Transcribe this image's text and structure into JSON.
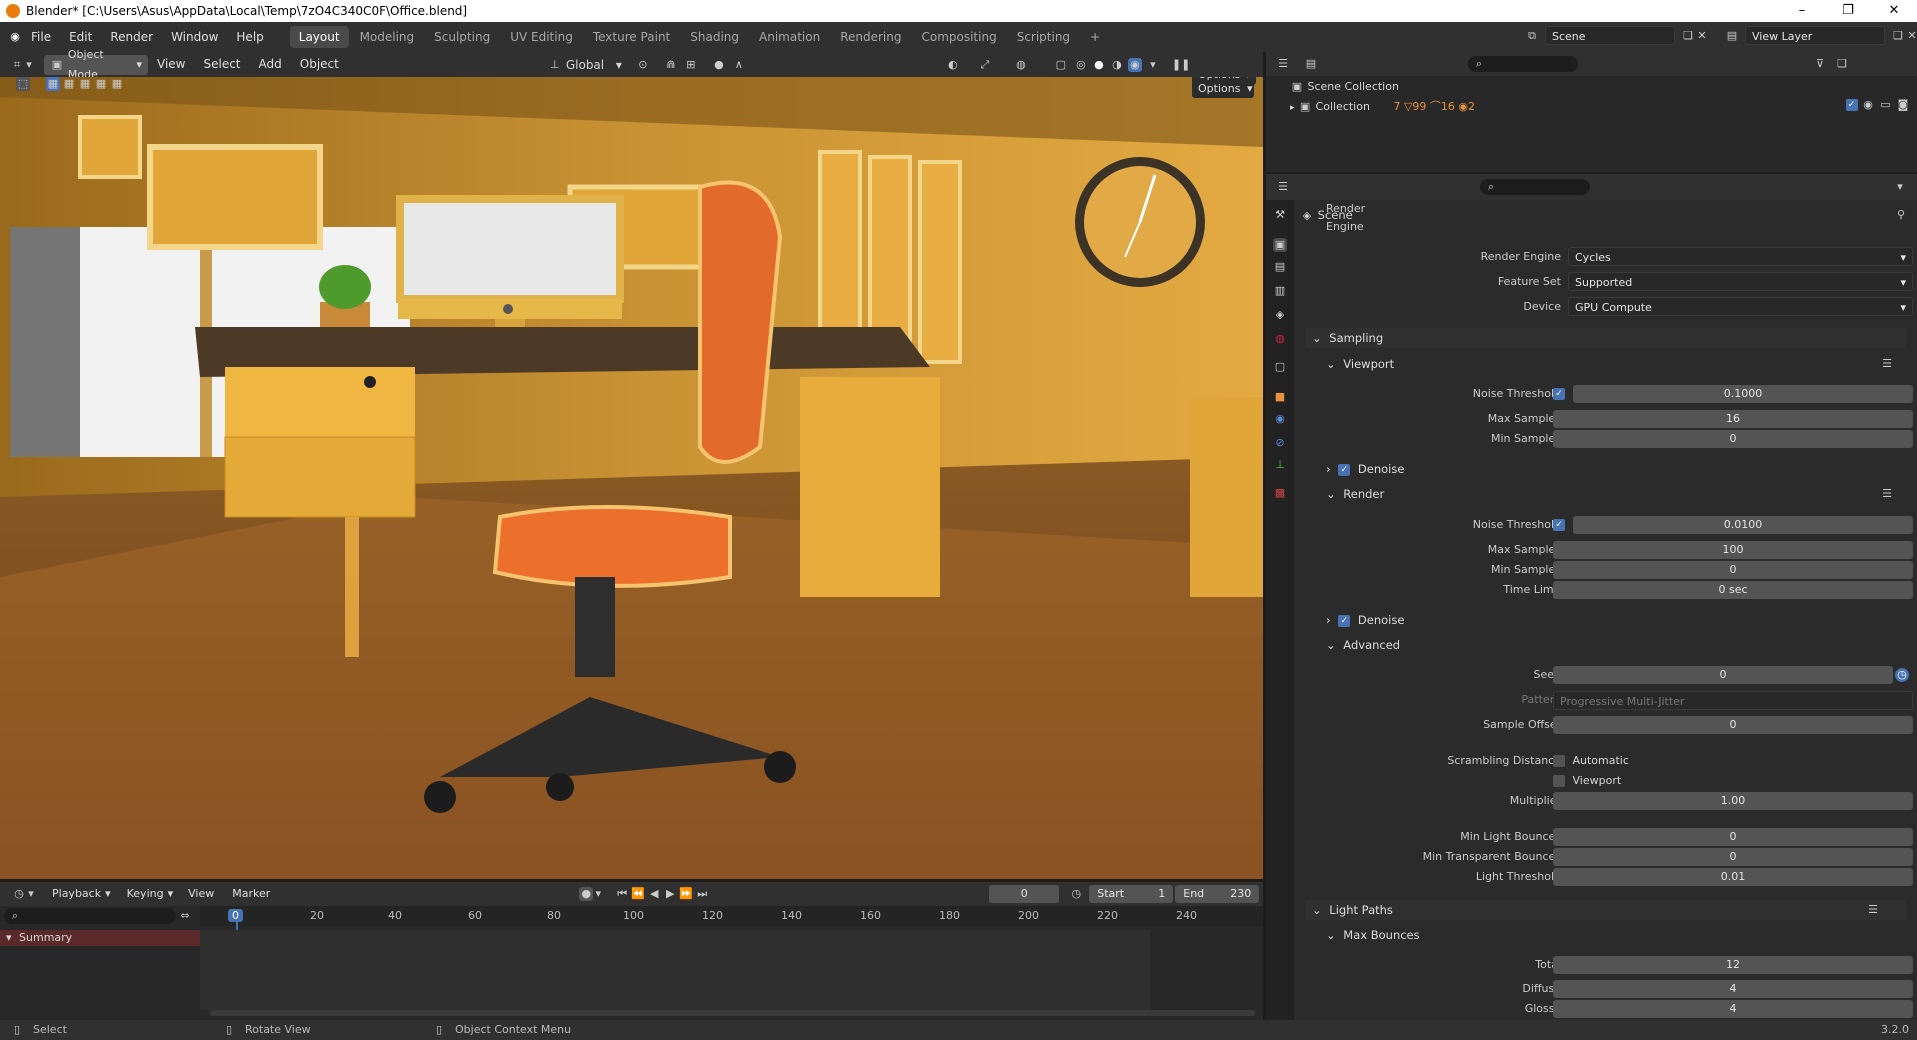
{
  "window": {
    "title": "Blender* [C:\\Users\\Asus\\AppData\\Local\\Temp\\7zO4C340C0F\\Office.blend]",
    "controls": [
      "–",
      "❐",
      "✕"
    ]
  },
  "topbar": {
    "menus": [
      "File",
      "Edit",
      "Render",
      "Window",
      "Help"
    ],
    "workspaces": [
      "Layout",
      "Modeling",
      "Sculpting",
      "UV Editing",
      "Texture Paint",
      "Shading",
      "Animation",
      "Rendering",
      "Compositing",
      "Scripting"
    ],
    "active_workspace": "Layout",
    "add_workspace": "+",
    "scene": "Scene",
    "view_layer": "View Layer"
  },
  "viewport_header": {
    "mode": "Object Mode",
    "menus": [
      "View",
      "Select",
      "Add",
      "Object"
    ],
    "orientation": "Global",
    "options": "Options"
  },
  "timeline": {
    "menus": [
      "Playback",
      "Keying",
      "View",
      "Marker"
    ],
    "current_frame": "0",
    "start_label": "Start",
    "start": "1",
    "end_label": "End",
    "end": "230",
    "ruler": [
      "0",
      "20",
      "40",
      "60",
      "80",
      "100",
      "120",
      "140",
      "160",
      "180",
      "200",
      "220",
      "240"
    ],
    "summary": "Summary"
  },
  "statusbar": {
    "select": "Select",
    "rotate": "Rotate View",
    "context": "Object Context Menu",
    "version": "3.2.0"
  },
  "outliner": {
    "scene_collection": "Scene Collection",
    "collection": "Collection",
    "counts": [
      "7",
      "99",
      "16",
      "2"
    ]
  },
  "properties": {
    "context": "Scene",
    "render_engine_label": "Render Engine",
    "render_engine": "Cycles",
    "feature_set_label": "Feature Set",
    "feature_set": "Supported",
    "device_label": "Device",
    "device": "GPU Compute",
    "sampling": "Sampling",
    "viewport": "Viewport",
    "vp_noise_label": "Noise Threshold",
    "vp_noise": "0.1000",
    "vp_max_label": "Max Samples",
    "vp_max": "16",
    "vp_min_label": "Min Samples",
    "vp_min": "0",
    "denoise": "Denoise",
    "render": "Render",
    "r_noise_label": "Noise Threshold",
    "r_noise": "0.0100",
    "r_max_label": "Max Samples",
    "r_max": "100",
    "r_min_label": "Min Samples",
    "r_min": "0",
    "time_limit_label": "Time Limit",
    "time_limit": "0 sec",
    "advanced": "Advanced",
    "seed_label": "Seed",
    "seed": "0",
    "pattern_label": "Pattern",
    "pattern": "Progressive Multi-Jitter",
    "sample_offset_label": "Sample Offset",
    "sample_offset": "0",
    "scrambling_label": "Scrambling Distance",
    "automatic": "Automatic",
    "viewport_chk": "Viewport",
    "multiplier_label": "Multiplier",
    "multiplier": "1.00",
    "min_light_label": "Min Light Bounces",
    "min_light": "0",
    "min_trans_label": "Min Transparent Bounces",
    "min_trans": "0",
    "light_thresh_label": "Light Threshold",
    "light_thresh": "0.01",
    "light_paths": "Light Paths",
    "max_bounces": "Max Bounces",
    "total_label": "Total",
    "total": "12",
    "diffuse_label": "Diffuse",
    "diffuse": "4",
    "glossy_label": "Glossy",
    "glossy": "4"
  }
}
